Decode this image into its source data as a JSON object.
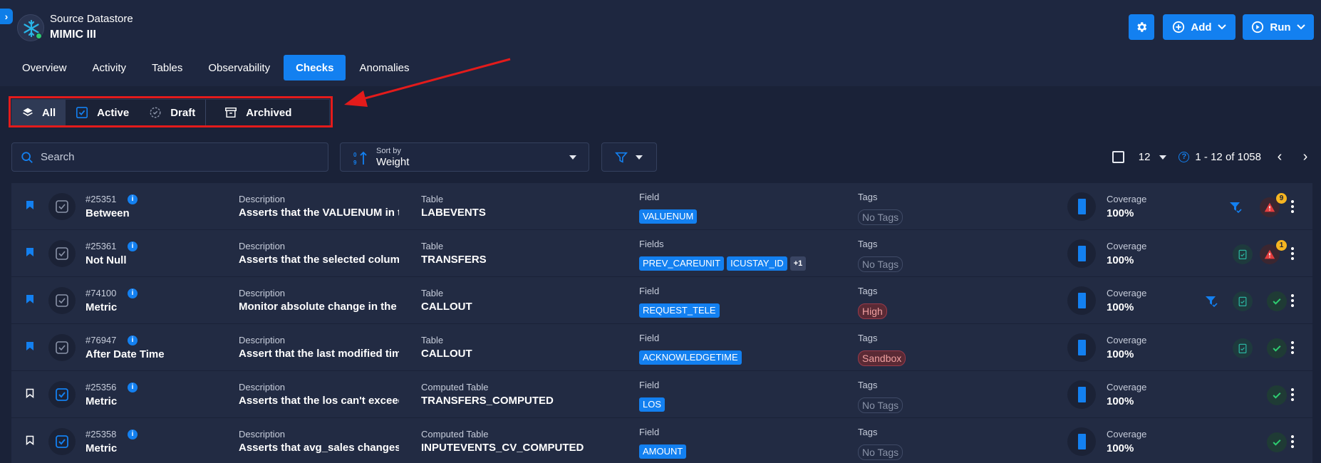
{
  "datastore": {
    "type": "Source Datastore",
    "name": "MIMIC III"
  },
  "header_buttons": {
    "add_label": "Add",
    "run_label": "Run"
  },
  "nav": {
    "tabs": [
      "Overview",
      "Activity",
      "Tables",
      "Observability",
      "Checks",
      "Anomalies"
    ],
    "active": "Checks"
  },
  "status_filter": {
    "all": "All",
    "active": "Active",
    "draft": "Draft",
    "archived": "Archived"
  },
  "search": {
    "placeholder": "Search"
  },
  "sort": {
    "label": "Sort by",
    "value": "Weight"
  },
  "pagination": {
    "per_page": "12",
    "range": "1 - 12 of 1058"
  },
  "colors": {
    "accent": "#1380f0",
    "background": "#1a2238",
    "row": "#222b43",
    "highlight": "#e31b1b"
  },
  "checks": [
    {
      "id": "#25351",
      "rule": "Between",
      "desc_label": "Description",
      "description": "Asserts that the VALUENUM in th...",
      "table_label": "Table",
      "table": "LABEVENTS",
      "field_label": "Field",
      "fields": [
        "VALUENUM"
      ],
      "tags_label": "Tags",
      "tag": "No Tags",
      "coverage_label": "Coverage",
      "coverage": "100%",
      "anomalies": "9"
    },
    {
      "id": "#25361",
      "rule": "Not Null",
      "desc_label": "Description",
      "description": "Asserts that the selected column...",
      "table_label": "Table",
      "table": "TRANSFERS",
      "field_label": "Fields",
      "fields": [
        "PREV_CAREUNIT",
        "ICUSTAY_ID",
        "+1"
      ],
      "tags_label": "Tags",
      "tag": "No Tags",
      "coverage_label": "Coverage",
      "coverage": "100%",
      "anomalies": "1"
    },
    {
      "id": "#74100",
      "rule": "Metric",
      "desc_label": "Description",
      "description": "Monitor absolute change in the m...",
      "table_label": "Table",
      "table": "CALLOUT",
      "field_label": "Field",
      "fields": [
        "REQUEST_TELE"
      ],
      "tags_label": "Tags",
      "tag": "High",
      "coverage_label": "Coverage",
      "coverage": "100%"
    },
    {
      "id": "#76947",
      "rule": "After Date Time",
      "desc_label": "Description",
      "description": "Assert that the last modified time...",
      "table_label": "Table",
      "table": "CALLOUT",
      "field_label": "Field",
      "fields": [
        "ACKNOWLEDGETIME"
      ],
      "tags_label": "Tags",
      "tag": "Sandbox",
      "coverage_label": "Coverage",
      "coverage": "100%"
    },
    {
      "id": "#25356",
      "rule": "Metric",
      "desc_label": "Description",
      "description": "Asserts that the los can't exceed t...",
      "table_label": "Computed Table",
      "table": "TRANSFERS_COMPUTED",
      "field_label": "Field",
      "fields": [
        "LOS"
      ],
      "tags_label": "Tags",
      "tag": "No Tags",
      "coverage_label": "Coverage",
      "coverage": "100%"
    },
    {
      "id": "#25358",
      "rule": "Metric",
      "desc_label": "Description",
      "description": "Asserts that avg_sales changes b...",
      "table_label": "Computed Table",
      "table": "INPUTEVENTS_CV_COMPUTED",
      "field_label": "Field",
      "fields": [
        "AMOUNT"
      ],
      "tags_label": "Tags",
      "tag": "No Tags",
      "coverage_label": "Coverage",
      "coverage": "100%"
    }
  ]
}
